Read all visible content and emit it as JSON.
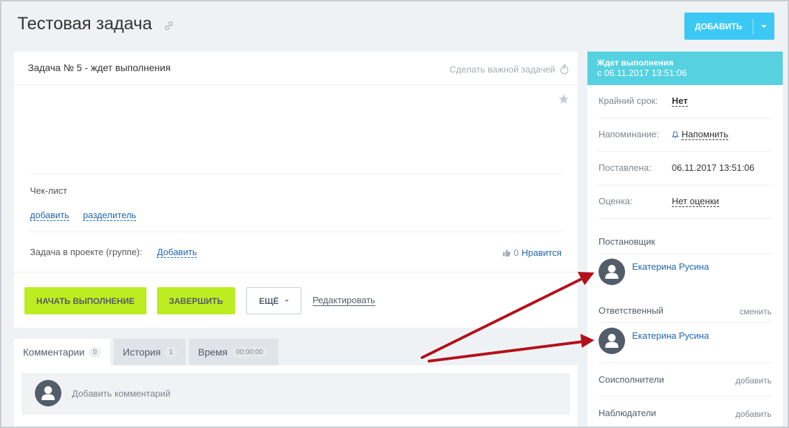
{
  "page": {
    "title": "Тестовая задача"
  },
  "header": {
    "add_button": "ДОБАВИТЬ"
  },
  "task": {
    "title": "Задача № 5 - ждет выполнения",
    "make_important": "Сделать важной задачей",
    "checklist": {
      "label": "Чек-лист",
      "add_link": "добавить",
      "separator_link": "разделитель"
    },
    "project": {
      "label": "Задача в проекте (группе):",
      "add_link": "Добавить"
    },
    "like": {
      "count": "0",
      "label": "Нравится"
    },
    "buttons": {
      "start": "НАЧАТЬ ВЫПОЛНЕНИЕ",
      "finish": "ЗАВЕРШИТЬ",
      "more": "ЕЩЁ",
      "edit": "Редактировать"
    }
  },
  "tabs": [
    {
      "label": "Комментарии",
      "badge": "0"
    },
    {
      "label": "История",
      "badge": "1"
    },
    {
      "label": "Время",
      "badge": "00:00:00"
    }
  ],
  "comments": {
    "placeholder": "Добавить комментарий"
  },
  "sidebar": {
    "status_line1": "Ждет выполнения",
    "status_line2": "с 06.11.2017 13:51:06",
    "deadline": {
      "label": "Крайний срок:",
      "value": "Нет"
    },
    "reminder": {
      "label": "Напоминание:",
      "value": "Напомнить"
    },
    "created": {
      "label": "Поставлена:",
      "value": "06.11.2017 13:51:06"
    },
    "rating": {
      "label": "Оценка:",
      "value": "Нет оценки"
    },
    "creator": {
      "title": "Постановщик",
      "name": "Екатерина Русина"
    },
    "responsible": {
      "title": "Ответственный",
      "action": "сменить",
      "name": "Екатерина Русина"
    },
    "coexecutors": {
      "title": "Соисполнители",
      "action": "добавить"
    },
    "observers": {
      "title": "Наблюдатели",
      "action": "добавить"
    }
  },
  "colors": {
    "accent_blue": "#3bc8f5",
    "status_cyan": "#56d1e0",
    "green_button": "#bbed21",
    "arrow_red": "#b3111a"
  }
}
